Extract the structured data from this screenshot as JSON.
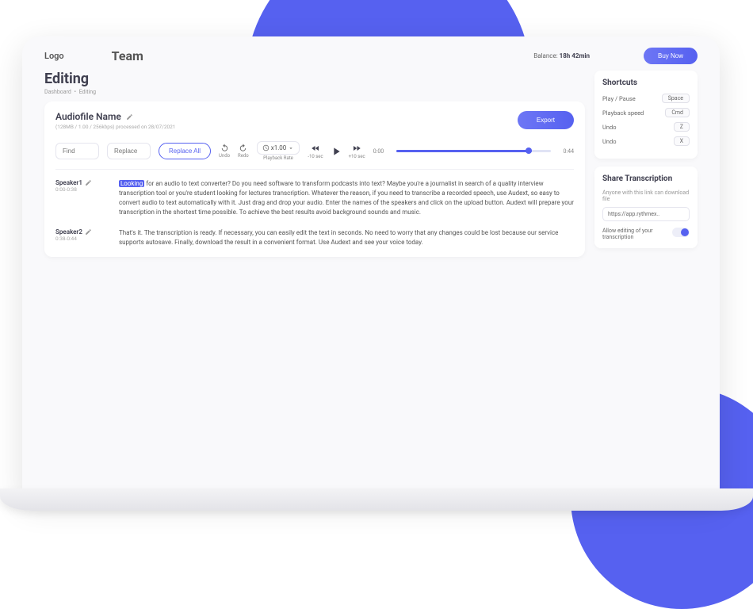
{
  "logo": "Logo",
  "team_title": "Team",
  "balance_label": "Balance:",
  "balance_value": "18h 42min",
  "buy_now": "Buy Now",
  "page_title": "Editing",
  "breadcrumb": {
    "root": "Dashboard",
    "sep": "•",
    "current": "Editing"
  },
  "file": {
    "name": "Audiofile Name",
    "meta": "(128MB / 1.00 / 256kbps) processed on 28/07/2021",
    "export": "Export"
  },
  "toolbar": {
    "find": "Find",
    "replace": "Replace",
    "replace_all": "Replace All",
    "undo": "Undo",
    "redo": "Redo",
    "rate_value": "x1.00",
    "rate_label": "Playback Rate",
    "back10": "-10 sec",
    "fwd10": "+10 sec",
    "time_start": "0:00",
    "time_end": "0:44"
  },
  "transcript": [
    {
      "speaker": "Speaker1",
      "time": "0:00-0:38",
      "highlight": "Looking",
      "text": " for an audio to text converter? Do you need software to transform podcasts into text? Maybe you're a journalist in search of a quality interview transcription tool or you're student looking for lectures transcription. Whatever the reason, if you need to transcribe a recorded speech, use Audext, so easy to convert audio to text automatically with it. Just drag and drop your audio. Enter the names of the speakers and click on the upload button. Audext will prepare your transcription in the shortest time possible. To achieve the best results avoid background sounds and music."
    },
    {
      "speaker": "Speaker2",
      "time": "0:38-0:44",
      "highlight": "",
      "text": "That's it. The transcription is ready. If necessary, you can easily edit the text in seconds. No need to worry that any changes could be lost because our service supports autosave. Finally, download the result in a convenient format. Use Audext and see your voice today."
    }
  ],
  "shortcuts": {
    "title": "Shortcuts",
    "items": [
      {
        "label": "Play / Pause",
        "key": "Space"
      },
      {
        "label": "Playback speed",
        "key": "Cmd"
      },
      {
        "label": "Undo",
        "key": "Z"
      },
      {
        "label": "Undo",
        "key": "X"
      }
    ]
  },
  "share": {
    "title": "Share Transcription",
    "desc": "Anyone with this link can download file",
    "url": "https://app.rythmex..",
    "toggle_label": "Allow editing of your transcription"
  }
}
